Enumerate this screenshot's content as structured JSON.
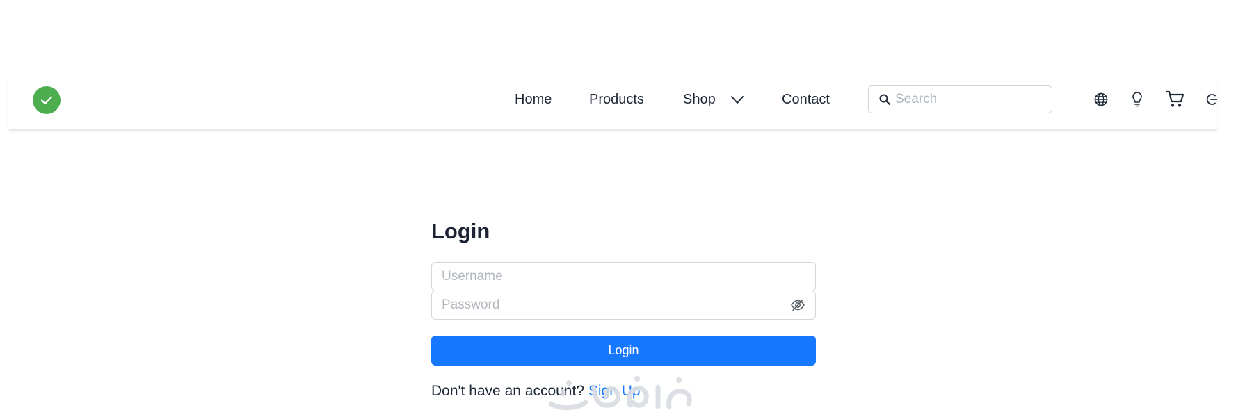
{
  "nav": {
    "links": [
      "Home",
      "Products",
      "Shop",
      "Contact"
    ],
    "search_placeholder": "Search",
    "icons": {
      "logo": "check-circle-icon",
      "shop_dropdown": "chevron-down-icon",
      "language": "globe-icon",
      "theme": "lightbulb-icon",
      "cart": "cart-icon",
      "account": "logout-icon"
    }
  },
  "login": {
    "title": "Login",
    "username_placeholder": "Username",
    "password_placeholder": "Password",
    "button_label": "Login",
    "signup_prompt": "Don't have an account?",
    "signup_link": "Sign Up"
  },
  "colors": {
    "logo_green": "#4cae4f",
    "primary_blue": "#1677ff",
    "text_dark": "#1f2937"
  }
}
